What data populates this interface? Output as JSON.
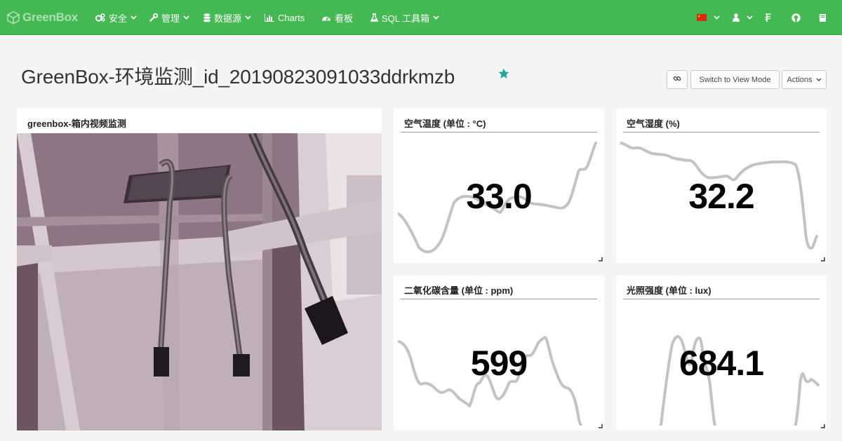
{
  "brand": {
    "name": "GreenBox"
  },
  "nav": {
    "security": "安全",
    "manage": "管理",
    "datasource": "数据源",
    "charts": "Charts",
    "dashboards": "看板",
    "sql": "SQL 工具箱"
  },
  "dashboard": {
    "title": "GreenBox-环境监测_id_20190823091033ddrkmzb",
    "switch_label": "Switch to View Mode",
    "actions_label": "Actions"
  },
  "panels": {
    "video": {
      "title": "greenbox-箱内视频监测"
    },
    "temperature": {
      "title": "空气温度 (单位 : °C)",
      "value": "33.0"
    },
    "humidity": {
      "title": "空气湿度 (%)",
      "value": "32.2"
    },
    "co2": {
      "title": "二氧化碳含量 (单位 : ppm)",
      "value": "599"
    },
    "light": {
      "title": "光照强度 (单位 : lux)",
      "value": "684.1"
    }
  },
  "colors": {
    "navbar": "#44b953",
    "star": "#1fa89a",
    "sparkline": "#c3c3c3",
    "page_background": "#f5f5f5"
  },
  "icons": {
    "security": "cogs-icon",
    "manage": "wrench-icon",
    "datasource": "database-icon",
    "charts": "bar-chart-icon",
    "dashboards": "dashboard-gauge-icon",
    "sql": "flask-icon",
    "language": "china-flag-icon",
    "user": "user-icon",
    "version": "currency-icon",
    "github": "github-icon",
    "docs": "book-icon",
    "share": "link-icon",
    "favorite": "star-icon"
  }
}
